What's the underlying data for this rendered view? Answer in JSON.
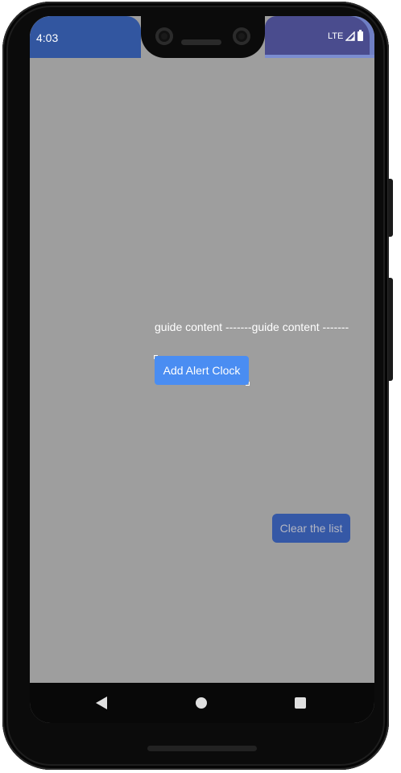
{
  "statusbar": {
    "time": "4:03",
    "network": "LTE",
    "icons": [
      "signal-icon",
      "battery-icon"
    ]
  },
  "main": {
    "guide_text": "guide content -------guide content -------",
    "add_button_label": "Add Alert Clock",
    "clear_button_label": "Clear the list"
  },
  "navbar": {
    "icons": [
      "back-icon",
      "home-icon",
      "recents-icon"
    ]
  },
  "colors": {
    "background_overlay": "#9e9e9e",
    "add_button": "#4a8df2",
    "clear_button": "#3558a6",
    "status_left": "#3256a0",
    "status_right": "#4a4c8e"
  }
}
